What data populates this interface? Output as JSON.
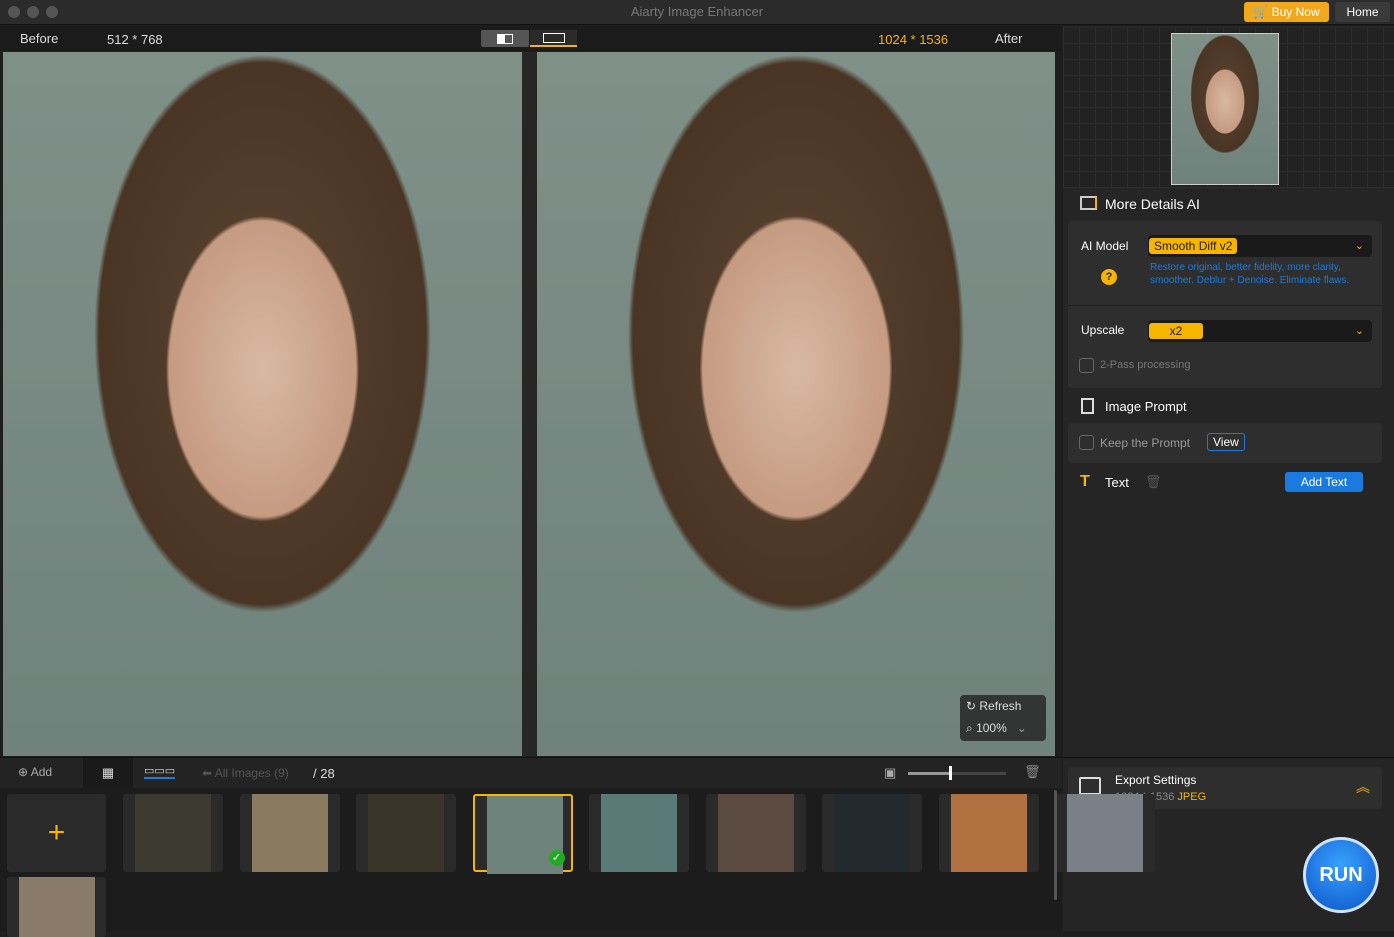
{
  "window": {
    "title": "Aiarty Image Enhancer",
    "buy_now": "Buy Now",
    "home": "Home"
  },
  "header": {
    "before": "Before",
    "before_size": "512 * 768",
    "after_size": "1024 * 1536",
    "after": "After"
  },
  "preview": {
    "refresh": "Refresh",
    "zoom": "100%"
  },
  "sidebar": {
    "section_title": "More Details AI",
    "ai_model_label": "AI Model",
    "ai_model_value": "Smooth Diff v2",
    "ai_model_desc": "Restore original, better fidelity, more clarity, smoother. Deblur + Denoise. Eliminate flaws.",
    "upscale_label": "Upscale",
    "upscale_value": "x2",
    "two_pass": "2-Pass processing",
    "image_prompt": "Image Prompt",
    "keep_prompt": "Keep the Prompt",
    "view": "View",
    "text_label": "Text",
    "add_text": "Add Text",
    "export_title": "Export Settings",
    "export_size": "1024 * 1536",
    "export_format": "JPEG",
    "run": "RUN"
  },
  "bottom": {
    "add": "Add",
    "all_images": "All Images (9)",
    "total": "/ 28"
  },
  "thumbnails": [
    {
      "color": "#3a3a30"
    },
    {
      "color": "#8a7a60"
    },
    {
      "color": "#3a3528"
    },
    {
      "color": "#6f827b",
      "selected": true
    },
    {
      "color": "#5a7a78"
    },
    {
      "color": "#5a4a40"
    },
    {
      "color": "#222a30"
    },
    {
      "color": "#b07040"
    },
    {
      "color": "#7a8088"
    }
  ],
  "accent": "#f7b500",
  "link_color": "#1a7ae0"
}
